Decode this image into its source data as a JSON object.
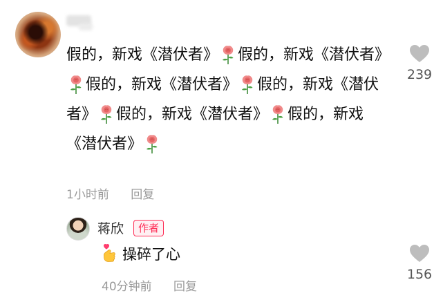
{
  "comment": {
    "segments": [
      "假的，新戏《潜伏者》",
      "假的，新戏《潜伏者》",
      "假的，新戏《潜伏者》",
      "假的，新戏《潜伏者》",
      "假的，新戏《潜伏者》",
      "假的，新戏《潜伏者》"
    ],
    "emoji": "rose-icon",
    "time": "1小时前",
    "reply_label": "回复",
    "likes": "239"
  },
  "reply": {
    "name": "蒋欣",
    "author_badge": "作者",
    "text": "操碎了心",
    "emoji": "heart-hand-icon",
    "time": "40分钟前",
    "reply_label": "回复",
    "likes": "156"
  },
  "colors": {
    "accent": "#fe2c55",
    "meta_text": "#9a9a9a"
  }
}
